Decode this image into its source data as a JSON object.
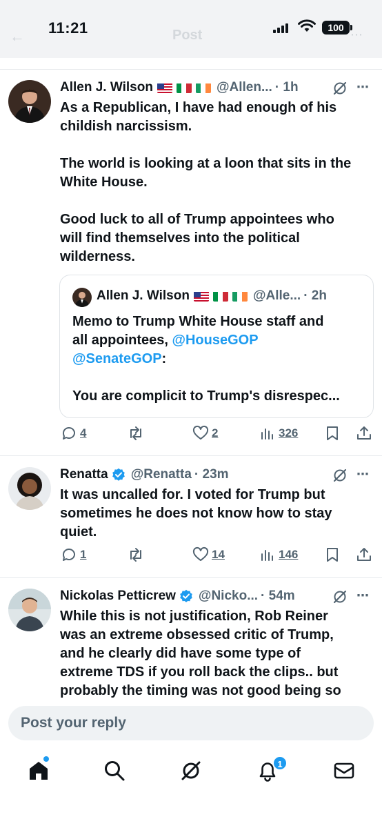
{
  "status_bar": {
    "time": "11:21",
    "battery": "100"
  },
  "header": {
    "title": "Post"
  },
  "tweets": [
    {
      "name": "Allen J. Wilson",
      "handle": "@Allen...",
      "time": "· 1h",
      "text_lines": [
        "As a Republican, I have had enough of his",
        "childish narcissism.",
        "",
        "The world is looking at a loon that sits in the",
        "White House.",
        "",
        "Good luck to all of Trump appointees who",
        "will find themselves into the political",
        "wilderness."
      ],
      "replies": "4",
      "likes": "2",
      "views": "326"
    },
    {
      "name": "Renatta",
      "handle": "@Renatta",
      "time": "· 23m",
      "text_lines": [
        "It was uncalled for. I voted for Trump but",
        "sometimes he does not know how to stay",
        "quiet."
      ],
      "replies": "1",
      "likes": "14",
      "views": "146"
    },
    {
      "name": "Nickolas Petticrew",
      "handle": "@Nicko...",
      "time": "· 54m",
      "text_lines": [
        "While this is not justification, Rob Reiner",
        "was an extreme obsessed critic of Trump,",
        "and he clearly did have some type of",
        "extreme TDS if you roll back the clips.. but",
        "probably the timing was not good being so"
      ]
    }
  ],
  "quote": {
    "name": "Allen J. Wilson",
    "handle": "@Alle...",
    "time": "· 2h",
    "line1": "Memo to Trump White House staff and",
    "line2_text": "all appointees, ",
    "mention1": "@HouseGOP",
    "mention2": "@SenateGOP",
    "colon": ":",
    "line4": "You are complicit to Trump's disrespec..."
  },
  "reply_bar": {
    "placeholder": "Post your reply"
  },
  "nav": {
    "notifications_badge": "1"
  },
  "colors": {
    "accent": "#1d9bf0",
    "muted": "#536471",
    "text": "#0f1419"
  }
}
